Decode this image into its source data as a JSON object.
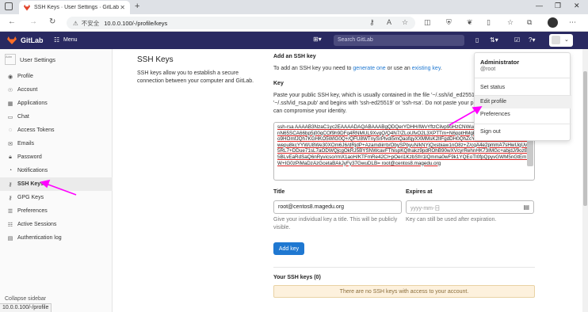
{
  "browser": {
    "tab_title": "SSH Keys · User Settings · GitLab",
    "insecure_label": "不安全",
    "url": "10.0.0.100/-/profile/keys",
    "status_url": "10.0.0.100/-/profile"
  },
  "gitlab_header": {
    "brand": "GitLab",
    "menu_label": "Menu",
    "search_placeholder": "Search GitLab"
  },
  "sidebar": {
    "title": "User Settings",
    "avatar_text": "Adm",
    "items": [
      {
        "label": "Profile",
        "icon": "user-icon"
      },
      {
        "label": "Account",
        "icon": "account-icon"
      },
      {
        "label": "Applications",
        "icon": "applications-icon"
      },
      {
        "label": "Chat",
        "icon": "chat-icon"
      },
      {
        "label": "Access Tokens",
        "icon": "token-icon"
      },
      {
        "label": "Emails",
        "icon": "email-icon"
      },
      {
        "label": "Password",
        "icon": "lock-icon"
      },
      {
        "label": "Notifications",
        "icon": "bell-icon"
      },
      {
        "label": "SSH Keys",
        "icon": "key-icon",
        "active": true
      },
      {
        "label": "GPG Keys",
        "icon": "key-icon"
      },
      {
        "label": "Preferences",
        "icon": "preferences-icon"
      },
      {
        "label": "Active Sessions",
        "icon": "sessions-icon"
      },
      {
        "label": "Authentication log",
        "icon": "log-icon"
      }
    ],
    "collapse_label": "Collapse sidebar"
  },
  "intro": {
    "heading": "SSH Keys",
    "description": "SSH keys allow you to establish a secure connection between your computer and GitLab."
  },
  "add_key": {
    "heading": "Add an SSH key",
    "line_pre": "To add an SSH key you need to ",
    "link1": "generate one",
    "line_mid": " or use an ",
    "link2": "existing key",
    "line_end": ".",
    "key_label": "Key",
    "key_help": "Paste your public SSH key, which is usually contained in the file '~/.ssh/id_ed25519.pub' or '~/.ssh/id_rsa.pub' and begins with 'ssh-ed25519' or 'ssh-rsa'. Do not paste your private SSH key, as that can compromise your identity.",
    "key_value": "ssh-rsa AAAAB3NzaC1yc2EAAAADAQABAAABgQDQerYDHH/lWvYftzCilvp9oHzCNWu/8XKV+MgKKn8hNH0NFnN65SCA66bp5j00qCOf9h9DFq4RNMUL9XvqQ/Q4N7/ZLoUfvO2L3XPTTm+N6pptHMgBtq8w5Jw4B49w5BTJswo9HOmfJQh7KGHKO5WIG0Q+/QFU8WTnySrPlvdi5mQaofqyXXMMsK2lIFgdDH0QhZcYJlkpC63BEhfgbvnhl0JVjwepu8kcYYWU8We30XOm6J6/dRjdP+Azamdiirrb/ObySPbyuN/kNYjQxsbiaw1nO8z+Z/cqA4e2pmmA7sHwUqUve5RL7+DDue71sL7aODWQjcgOkRJ5BYSNWcavFThispKQIhakz9pdROhB90wXVcyrRehnHK73IMGc+abjdJ/9ozBe5BLvEaRdSaQ6nRyvicso/rmX1aoH/KTFmRe42Cl+pOeri1KzbSfrr1lQmma0wF9k1YQEoTI0fpQpyvGWM5nGtEm7W+IG0zPiMaDzAzGcetaBAkJyFy37GwuDLB= root@centos8.magedu.org",
    "title_label": "Title",
    "title_value": "root@centos8.magedu.org",
    "title_hint": "Give your individual key a title. This will be publicly visible.",
    "expires_label": "Expires at",
    "expires_placeholder": "yyyy-mm-日",
    "expires_hint": "Key can still be used after expiration.",
    "add_button": "Add key"
  },
  "your_keys": {
    "heading": "Your SSH keys (0)",
    "empty_message": "There are no SSH keys with access to your account."
  },
  "user_dropdown": {
    "name": "Administrator",
    "handle": "@root",
    "items": [
      "Set status",
      "Edit profile",
      "Preferences",
      "Sign out"
    ]
  },
  "colors": {
    "header_bg": "#292961",
    "accent": "#1f78d1",
    "annotation": "#ff00ff",
    "gitlab_orange": "#fc6d26"
  }
}
